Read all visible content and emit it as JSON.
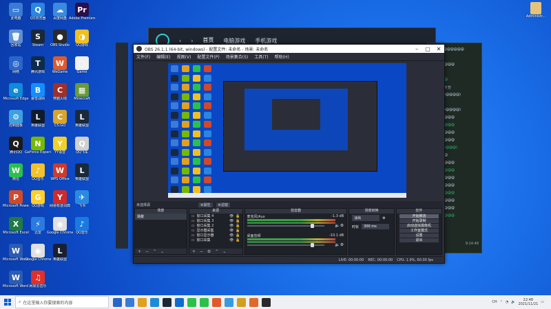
{
  "desktop": {
    "icons": [
      {
        "label": "此电脑",
        "col": 0,
        "row": 0,
        "color": "#3a7bd5",
        "glyph": "▭"
      },
      {
        "label": "回收站",
        "col": 0,
        "row": 1,
        "color": "#5f8fd0",
        "glyph": "🗑"
      },
      {
        "label": "网络",
        "col": 0,
        "row": 2,
        "color": "#2a66c9",
        "glyph": "◎"
      },
      {
        "label": "Microsoft Edge",
        "col": 0,
        "row": 3,
        "color": "#0f8bd8",
        "glyph": "e"
      },
      {
        "label": "控制面板",
        "col": 0,
        "row": 4,
        "color": "#3fa0e0",
        "glyph": "⚙"
      },
      {
        "label": "腾讯QQ",
        "col": 0,
        "row": 5,
        "color": "#1b1b1b",
        "glyph": "Q"
      },
      {
        "label": "微信",
        "col": 0,
        "row": 6,
        "color": "#2ac14a",
        "glyph": "W"
      },
      {
        "label": "Microsoft PowerPoint",
        "col": 0,
        "row": 7,
        "color": "#d04a2a",
        "glyph": "P"
      },
      {
        "label": "Microsoft Excel",
        "col": 0,
        "row": 8,
        "color": "#1f7a43",
        "glyph": "X"
      },
      {
        "label": "Microsoft Word 2016",
        "col": 0,
        "row": 9,
        "color": "#2b5bb5",
        "glyph": "W"
      },
      {
        "label": "Microsoft Word 2016",
        "col": 0,
        "row": 10,
        "color": "#2b5bb5",
        "glyph": "W"
      },
      {
        "label": "QQ浏览器",
        "col": 1,
        "row": 0,
        "color": "#2a86e0",
        "glyph": "Q"
      },
      {
        "label": "Steam",
        "col": 1,
        "row": 1,
        "color": "#1b2838",
        "glyph": "S"
      },
      {
        "label": "腾讯游戏",
        "col": 1,
        "row": 2,
        "color": "#0d2b4a",
        "glyph": "T"
      },
      {
        "label": "暴雪战网",
        "col": 1,
        "row": 3,
        "color": "#148eff",
        "glyph": "B"
      },
      {
        "label": "英雄联盟",
        "col": 1,
        "row": 4,
        "color": "#0f1b2a",
        "glyph": "L"
      },
      {
        "label": "GeForce Experience",
        "col": 1,
        "row": 5,
        "color": "#76b900",
        "glyph": "N"
      },
      {
        "label": "QQ音乐",
        "col": 1,
        "row": 6,
        "color": "#f4c22a",
        "glyph": "♪"
      },
      {
        "label": "QQ游戏",
        "col": 1,
        "row": 7,
        "color": "#ffcf2a",
        "glyph": "G"
      },
      {
        "label": "迅雷",
        "col": 1,
        "row": 8,
        "color": "#2a7be0",
        "glyph": "⚡"
      },
      {
        "label": "Google Chrome",
        "col": 1,
        "row": 9,
        "color": "#e0e0e0",
        "glyph": "◉"
      },
      {
        "label": "网易云音乐",
        "col": 1,
        "row": 10,
        "color": "#e0302a",
        "glyph": "♫"
      },
      {
        "label": "百度网盘",
        "col": 2,
        "row": 0,
        "color": "#3a8ae0",
        "glyph": "☁"
      },
      {
        "label": "OBS Studio",
        "col": 2,
        "row": 1,
        "color": "#2a2a2a",
        "glyph": "●"
      },
      {
        "label": "WeGame",
        "col": 2,
        "row": 2,
        "color": "#e05a2a",
        "glyph": "W"
      },
      {
        "label": "穿越火线",
        "col": 2,
        "row": 3,
        "color": "#a0302a",
        "glyph": "C"
      },
      {
        "label": "CS:GO",
        "col": 2,
        "row": 4,
        "color": "#d8a42a",
        "glyph": "C"
      },
      {
        "label": "YY语音",
        "col": 2,
        "row": 5,
        "color": "#f0d02a",
        "glyph": "Y"
      },
      {
        "label": "WPS Office",
        "col": 2,
        "row": 6,
        "color": "#d03a2a",
        "glyph": "W"
      },
      {
        "label": "网易有道词典",
        "col": 2,
        "row": 7,
        "color": "#d02a2a",
        "glyph": "Y"
      },
      {
        "label": "Google Chrome",
        "col": 2,
        "row": 8,
        "color": "#e0e0e0",
        "glyph": "◉"
      },
      {
        "label": "英雄联盟",
        "col": 2,
        "row": 9,
        "color": "#1a2030",
        "glyph": "L"
      },
      {
        "label": "Adobe Premiere",
        "col": 3,
        "row": 0,
        "color": "#2a0f4a",
        "glyph": "Pr"
      },
      {
        "label": "QQ游戏",
        "col": 3,
        "row": 1,
        "color": "#f0c020",
        "glyph": "◑"
      },
      {
        "label": "Game",
        "col": 3,
        "row": 2,
        "color": "#f0f0f0",
        "glyph": "▢"
      },
      {
        "label": "Minecraft",
        "col": 3,
        "row": 3,
        "color": "#6a9a3a",
        "glyph": "▦"
      },
      {
        "label": "英雄联盟",
        "col": 3,
        "row": 4,
        "color": "#1a2a3a",
        "glyph": "L"
      },
      {
        "label": "QQ飞车",
        "col": 3,
        "row": 5,
        "color": "#d0d0d0",
        "glyph": "Q"
      },
      {
        "label": "英雄联盟",
        "col": 3,
        "row": 6,
        "color": "#1a2a3a",
        "glyph": "L"
      },
      {
        "label": "飞书",
        "col": 3,
        "row": 7,
        "color": "#2a8ae0",
        "glyph": "✈"
      },
      {
        "label": "QQ音乐",
        "col": 3,
        "row": 8,
        "color": "#1a7ae0",
        "glyph": "♪"
      }
    ],
    "right_icon_label": "Administr..."
  },
  "bg_app": {
    "tabs": [
      "首页",
      "电脑游戏",
      "手机游戏"
    ]
  },
  "chat_panel": {
    "lines": [
      "#174@@@@@@@",
      "等级等级",
      "@@@@@@@",
      "小队",
      "@@@@@",
      "@@@@十万",
      "(@@@@@@@@)",
      "@@了吧",
      "(@@@@@@@@)",
      "@@@@@@@",
      "@@@@@@@",
      "@@@@@@@",
      "@@@@@@@",
      "(@@@@@@@)",
      "@@@@@",
      "@@@@@@@",
      "@@@@@@@",
      "@@@@@@@",
      "@@@@@@@",
      "@@@@@@@",
      "@@@@@@@",
      "@@@@@@@",
      "@@@@@@@"
    ],
    "time": "9:14:48"
  },
  "obs": {
    "title": "OBS 26.1.1 (64-bit, windows) - 配置文件: 未命名 - 场景: 未命名",
    "menu": [
      "文件(F)",
      "编辑(E)",
      "视图(V)",
      "配置文件(P)",
      "场景集合(S)",
      "工具(T)",
      "帮助(H)"
    ],
    "scene_label": "未选择源",
    "toolbar": [
      "⚙属性",
      "⚙滤镜"
    ],
    "docks": {
      "scenes_hdr": "场景",
      "sources_hdr": "来源",
      "mixer_hdr": "混音器",
      "transitions_hdr": "场景转换",
      "controls_hdr": "控件"
    },
    "scenes": [
      "场景"
    ],
    "sources": [
      "窗口采集 4",
      "窗口采集 3",
      "窗口采集 2",
      "显示器采集",
      "窗口显示器",
      "窗口采集"
    ],
    "mixer": [
      {
        "name": "麦克风/Aux",
        "db": "-1.3 dB"
      },
      {
        "name": "桌面音频",
        "db": "-10.1 dB"
      }
    ],
    "transitions": {
      "type": "淡出",
      "duration_label": "时长",
      "duration": "300 ms"
    },
    "controls": [
      "开始推流",
      "开始录制",
      "启动虚拟摄像机",
      "工作室模式",
      "设置",
      "退出"
    ],
    "status": [
      "LIVE: 00:00:00",
      "REC: 00:00:00",
      "CPU: 1.9%, 60.00 fps"
    ]
  },
  "taskbar": {
    "search_placeholder": "在这里输入你要搜索的内容",
    "apps": [
      "#2a66c9",
      "#3a7bd5",
      "#e0a020",
      "#1f8bd8",
      "#1b2838",
      "#0f6bd0",
      "#2ac14a",
      "#2ac14a",
      "#e05a2a",
      "#3a9ae0",
      "#d0a020",
      "#e06a2a",
      "#2a2a2a"
    ],
    "tray_text": "CH",
    "time": "22:48",
    "date": "2021/11/21"
  }
}
